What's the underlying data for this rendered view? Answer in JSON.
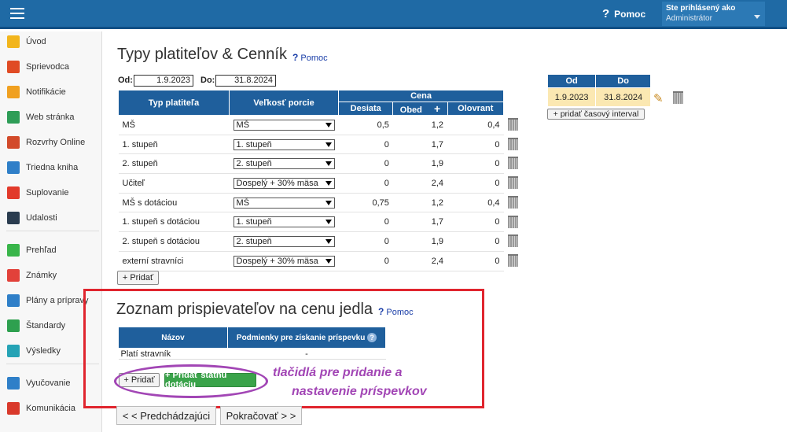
{
  "header": {
    "help": "Pomoc",
    "user_line1": "Ste prihlásený ako",
    "user_line2": "Administrátor"
  },
  "sidebar": {
    "items": [
      {
        "label": "Úvod",
        "icon": "star-icon",
        "color": "#f2b51c"
      },
      {
        "label": "Sprievodca",
        "icon": "wand-icon",
        "color": "#e04b24"
      },
      {
        "label": "Notifikácie",
        "icon": "envelope-icon",
        "color": "#f0a020"
      },
      {
        "label": "Web stránka",
        "icon": "home-icon",
        "color": "#2e9d57"
      },
      {
        "label": "Rozvrhy Online",
        "icon": "calendar-icon",
        "color": "#d24a2a"
      },
      {
        "label": "Triedna kniha",
        "icon": "book-icon",
        "color": "#2f7fc8"
      },
      {
        "label": "Suplovanie",
        "icon": "person-icon",
        "color": "#e23a2b"
      },
      {
        "label": "Udalosti",
        "icon": "events-icon",
        "color": "#2a3c4f"
      },
      {
        "label": "Prehľad",
        "icon": "check-icon",
        "color": "#39b54a"
      },
      {
        "label": "Známky",
        "icon": "grades-icon",
        "color": "#e2413a"
      },
      {
        "label": "Plány a prípravy",
        "icon": "briefcase-icon",
        "color": "#2f7fc8"
      },
      {
        "label": "Štandardy",
        "icon": "shield-icon",
        "color": "#2ea04f"
      },
      {
        "label": "Výsledky",
        "icon": "bar-chart-icon",
        "color": "#25a3b5"
      },
      {
        "label": "Vyučovanie",
        "icon": "open-book-icon",
        "color": "#2f7fc8"
      },
      {
        "label": "Komunikácia",
        "icon": "chat-icon",
        "color": "#d9392b"
      }
    ]
  },
  "page": {
    "title": "Typy platiteľov & Cenník",
    "help": "Pomoc",
    "od_label": "Od:",
    "od_value": "1.9.2023",
    "do_label": "Do:",
    "do_value": "31.8.2024"
  },
  "price_table": {
    "headers": {
      "type": "Typ platiteľa",
      "size": "Veľkosť porcie",
      "price": "Cena",
      "desiata": "Desiata",
      "obed": "Obed",
      "plus": "+",
      "olovrant": "Olovrant"
    },
    "rows": [
      {
        "type": "MŠ",
        "size": "MŠ",
        "desiata": "0,5",
        "obed": "1,2",
        "olovrant": "0,4"
      },
      {
        "type": "1. stupeň",
        "size": "1. stupeň",
        "desiata": "0",
        "obed": "1,7",
        "olovrant": "0"
      },
      {
        "type": "2. stupeň",
        "size": "2. stupeň",
        "desiata": "0",
        "obed": "1,9",
        "olovrant": "0"
      },
      {
        "type": "Učiteľ",
        "size": "Dospelý + 30% mäsa",
        "desiata": "0",
        "obed": "2,4",
        "olovrant": "0"
      },
      {
        "type": "MŠ s dotáciou",
        "size": "MŠ",
        "desiata": "0,75",
        "obed": "1,2",
        "olovrant": "0,4"
      },
      {
        "type": "1. stupeň s dotáciou",
        "size": "1. stupeň",
        "desiata": "0",
        "obed": "1,7",
        "olovrant": "0"
      },
      {
        "type": "2. stupeň s dotáciou",
        "size": "2. stupeň",
        "desiata": "0",
        "obed": "1,9",
        "olovrant": "0"
      },
      {
        "type": "externí stravníci",
        "size": "Dospelý + 30% mäsa",
        "desiata": "0",
        "obed": "2,4",
        "olovrant": "0"
      }
    ],
    "add": "+ Pridať"
  },
  "interval": {
    "od": "Od",
    "do": "Do",
    "row": {
      "od": "1.9.2023",
      "do": "31.8.2024"
    },
    "add": "+ pridať časový interval"
  },
  "contrib": {
    "title": "Zoznam prispievateľov na cenu jedla",
    "help": "Pomoc",
    "col_name": "Názov",
    "col_cond": "Podmienky pre získanie príspevku",
    "col_cond_help": "?",
    "rows": [
      {
        "name": "Platí stravník",
        "cond": "-"
      }
    ],
    "add": "+ Pridať",
    "add_state": "+ Pridať štátnu dotáciu"
  },
  "annotation": {
    "line1": "tlačidlá pre pridanie a",
    "line2": "nastavenie príspevkov"
  },
  "nav": {
    "prev": "< < Predchádzajúci",
    "next": "Pokračovať > >"
  }
}
